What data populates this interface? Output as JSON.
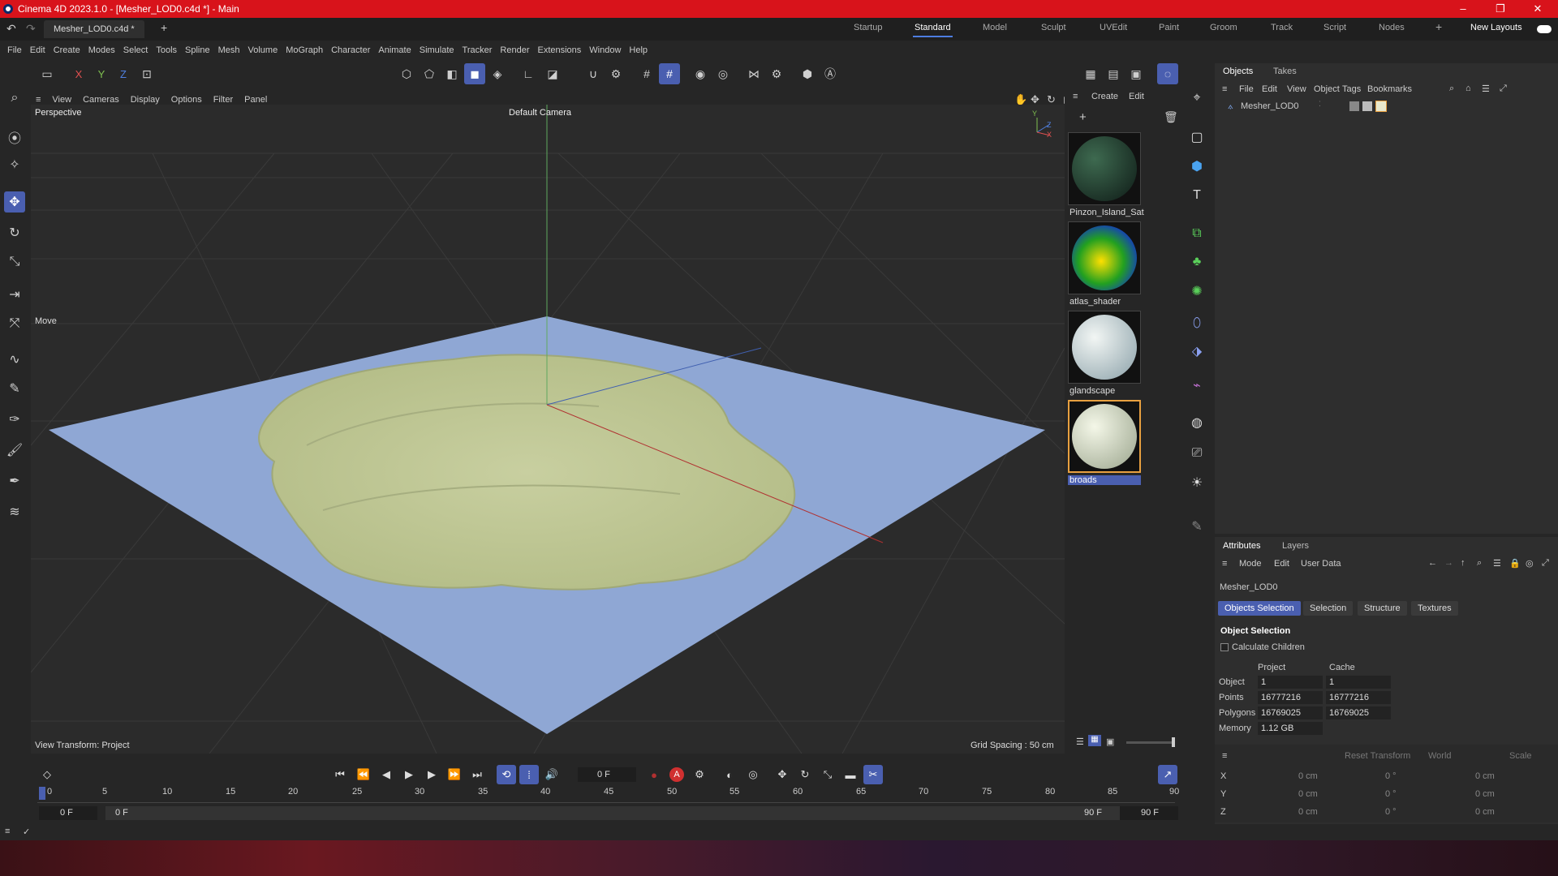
{
  "window": {
    "title": "Cinema 4D 2023.1.0 - [Mesher_LOD0.c4d *] - Main",
    "minimize": "–",
    "restore": "❐",
    "close": "✕"
  },
  "document_tab": {
    "label": "Mesher_LOD0.c4d *",
    "add": "+"
  },
  "layouts": {
    "items": [
      "Startup",
      "Standard",
      "Model",
      "Sculpt",
      "UVEdit",
      "Paint",
      "Groom",
      "Track",
      "Script",
      "Nodes"
    ],
    "active": "Standard",
    "new_layouts": "New Layouts",
    "add": "+"
  },
  "menu": [
    "File",
    "Edit",
    "Create",
    "Modes",
    "Select",
    "Tools",
    "Spline",
    "Mesh",
    "Volume",
    "MoGraph",
    "Character",
    "Animate",
    "Simulate",
    "Tracker",
    "Render",
    "Extensions",
    "Window",
    "Help"
  ],
  "axis_toggles": {
    "x": "X",
    "y": "Y",
    "z": "Z"
  },
  "viewport": {
    "menu": [
      "View",
      "Cameras",
      "Display",
      "Options",
      "Filter",
      "Panel"
    ],
    "projection": "Perspective",
    "camera": "Default Camera",
    "tool_label": "Move",
    "view_transform": "View Transform: Project",
    "grid_spacing": "Grid Spacing : 50 cm",
    "gizmo": {
      "y": "Y",
      "z": "Z",
      "x": "X"
    }
  },
  "material_manager": {
    "menu": [
      "Create",
      "Edit"
    ],
    "materials": [
      {
        "name": "Pinzon_Island_Sat",
        "colors": [
          "#3e6a50",
          "#0e1a16"
        ]
      },
      {
        "name": "atlas_shader",
        "colors": [
          "#ffe000",
          "#22a020",
          "#1230d0"
        ]
      },
      {
        "name": "glandscape",
        "colors": [
          "#f2f6f4",
          "#8aa0a8"
        ]
      },
      {
        "name": "broads",
        "colors": [
          "#f4f7e8",
          "#9aa48c"
        ],
        "selected": true
      }
    ]
  },
  "objects_panel": {
    "tabs": [
      "Objects",
      "Takes"
    ],
    "menu": [
      "File",
      "Edit",
      "View",
      "Object",
      "Tags",
      "Bookmarks"
    ],
    "object_name": "Mesher_LOD0"
  },
  "attributes": {
    "tabs": [
      "Attributes",
      "Layers"
    ],
    "menu": [
      "Mode",
      "Edit",
      "User Data"
    ],
    "object_name": "Mesher_LOD0",
    "subtabs": [
      "Objects Selection",
      "Selection",
      "Structure",
      "Textures"
    ],
    "active_subtab": "Objects Selection",
    "section_title": "Object Selection",
    "calculate_children": "Calculate Children",
    "columns": [
      "Project",
      "Cache"
    ],
    "rows": [
      {
        "label": "Object",
        "project": "1",
        "cache": "1"
      },
      {
        "label": "Points",
        "project": "16777216",
        "cache": "16777216"
      },
      {
        "label": "Polygons",
        "project": "16769025",
        "cache": "16769025"
      },
      {
        "label": "Memory",
        "project": "1.12 GB",
        "cache": ""
      }
    ]
  },
  "coordinates": {
    "reset_transform": "Reset Transform",
    "space": "World",
    "mode": "Scale",
    "rows": [
      {
        "axis": "X",
        "pos": "0 cm",
        "rot": "0 °",
        "scale": "0 cm"
      },
      {
        "axis": "Y",
        "pos": "0 cm",
        "rot": "0 °",
        "scale": "0 cm"
      },
      {
        "axis": "Z",
        "pos": "0 cm",
        "rot": "0 °",
        "scale": "0 cm"
      }
    ]
  },
  "timeline": {
    "current_frame": "0 F",
    "ticks": [
      "0",
      "5",
      "10",
      "15",
      "20",
      "25",
      "30",
      "35",
      "40",
      "45",
      "50",
      "55",
      "60",
      "65",
      "70",
      "75",
      "80",
      "85",
      "90"
    ],
    "start_field": "0 F",
    "range_start": "0 F",
    "range_end": "90 F",
    "end_field": "90 F",
    "record_label": "A"
  },
  "colors": {
    "accent": "#4a5fb0",
    "title_bar": "#d8131b",
    "water": "#8fa7d4",
    "island": "#c4cb9a"
  }
}
